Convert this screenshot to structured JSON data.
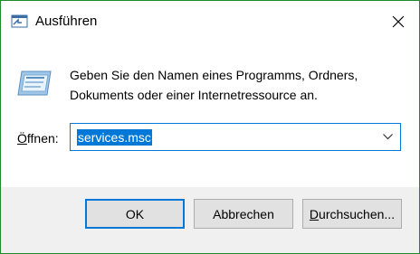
{
  "window": {
    "title": "Ausführen",
    "accent_color": "#1e8a2c",
    "title_icon": "run-dialog-icon"
  },
  "dialog": {
    "description": "Geben Sie den Namen eines Programms, Ordners, Dokuments oder einer Internetressource an.",
    "open_label_mnemonic": "Ö",
    "open_label_rest": "ffnen:",
    "open_value": "services.msc",
    "selection_color": "#0078d7"
  },
  "buttons": {
    "ok": "OK",
    "cancel": "Abbrechen",
    "browse_mnemonic": "D",
    "browse_rest": "urchsuchen..."
  },
  "icons": {
    "close": "close-icon",
    "dropdown": "chevron-down-icon",
    "run": "run-program-icon"
  }
}
